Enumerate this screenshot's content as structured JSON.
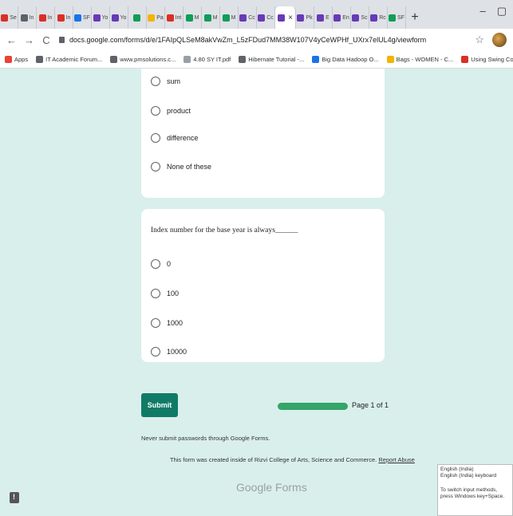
{
  "browser": {
    "tabs": [
      {
        "favicon_color": "#d93025",
        "glyph": "M",
        "label": "Se"
      },
      {
        "favicon_color": "#5f6368",
        "glyph": "◉",
        "label": "In"
      },
      {
        "favicon_color": "#d93025",
        "glyph": "M",
        "label": "In"
      },
      {
        "favicon_color": "#d93025",
        "glyph": "M",
        "label": "In"
      },
      {
        "favicon_color": "#1a73e8",
        "glyph": "▣",
        "label": "SF"
      },
      {
        "favicon_color": "#673ab7",
        "glyph": "▤",
        "label": "Yo"
      },
      {
        "favicon_color": "#673ab7",
        "glyph": "▤",
        "label": "Yo"
      },
      {
        "favicon_color": "#0f9d58",
        "glyph": "●",
        "label": ""
      },
      {
        "favicon_color": "#f4b400",
        "glyph": "▲",
        "label": "Pa"
      },
      {
        "favicon_color": "#d93025",
        "glyph": "M",
        "label": "Int"
      },
      {
        "favicon_color": "#0f9d58",
        "glyph": "▲",
        "label": "M"
      },
      {
        "favicon_color": "#0f9d58",
        "glyph": "▲",
        "label": "M"
      },
      {
        "favicon_color": "#0f9d58",
        "glyph": "▲",
        "label": "M"
      },
      {
        "favicon_color": "#673ab7",
        "glyph": "▤",
        "label": "Cc"
      },
      {
        "favicon_color": "#673ab7",
        "glyph": "▤",
        "label": "Cc"
      },
      {
        "favicon_color": "#673ab7",
        "glyph": "▤",
        "label": "",
        "active": true
      },
      {
        "favicon_color": "#673ab7",
        "glyph": "▤",
        "label": "Pk"
      },
      {
        "favicon_color": "#673ab7",
        "glyph": "▤",
        "label": "E"
      },
      {
        "favicon_color": "#673ab7",
        "glyph": "▤",
        "label": "En"
      },
      {
        "favicon_color": "#673ab7",
        "glyph": "▤",
        "label": "Sc"
      },
      {
        "favicon_color": "#673ab7",
        "glyph": "▤",
        "label": "Rc"
      },
      {
        "favicon_color": "#0f9d58",
        "glyph": "▦",
        "label": "SF"
      }
    ],
    "new_tab": "+",
    "window_controls": {
      "minimize": "–",
      "maximize": "▢"
    },
    "nav": {
      "back": "←",
      "forward": "→",
      "reload": "C"
    },
    "url": "docs.google.com/forms/d/e/1FAIpQLSeM8akVwZm_L5zFDud7MM38W107V4yCeWPHf_UXrx7elUL4g/viewform",
    "bookmarks": [
      {
        "label": "Apps",
        "icon_color": "#ea4335"
      },
      {
        "label": "IT Academic Forum...",
        "icon_color": "#5f6368"
      },
      {
        "label": "www.pmsolutions.c...",
        "icon_color": "#5f6368"
      },
      {
        "label": "4.80 SY IT.pdf",
        "icon_color": "#9aa0a6"
      },
      {
        "label": "Hibernate Tutorial -...",
        "icon_color": "#5f6368"
      },
      {
        "label": "Big Data Hadoop O...",
        "icon_color": "#1a73e8"
      },
      {
        "label": "Bags - WOMEN - C...",
        "icon_color": "#f4b400"
      },
      {
        "label": "Using Swing Comp...",
        "icon_color": "#d93025"
      }
    ]
  },
  "form": {
    "card1_options": [
      "sum",
      "product",
      "difference",
      "None of these"
    ],
    "question2": "Index number for the base year is always______",
    "card2_options": [
      "0",
      "100",
      "1000",
      "10000"
    ],
    "submit_label": "Submit",
    "progress_fraction": 1.0,
    "page_indicator": "Page 1 of 1",
    "password_note": "Never submit passwords through Google Forms.",
    "created_text": "This form was created inside of Rizvi College of Arts, Science and Commerce.",
    "report_link": "Report Abuse",
    "brand": "Google Forms"
  },
  "ime_popup": {
    "line1": "English (India)",
    "line2": "English (India) keyboard",
    "line3": "To switch input methods, press Windows key+Space."
  },
  "colors": {
    "accent": "#0f7b67",
    "progress": "#35a56a",
    "background": "#d9efec"
  }
}
